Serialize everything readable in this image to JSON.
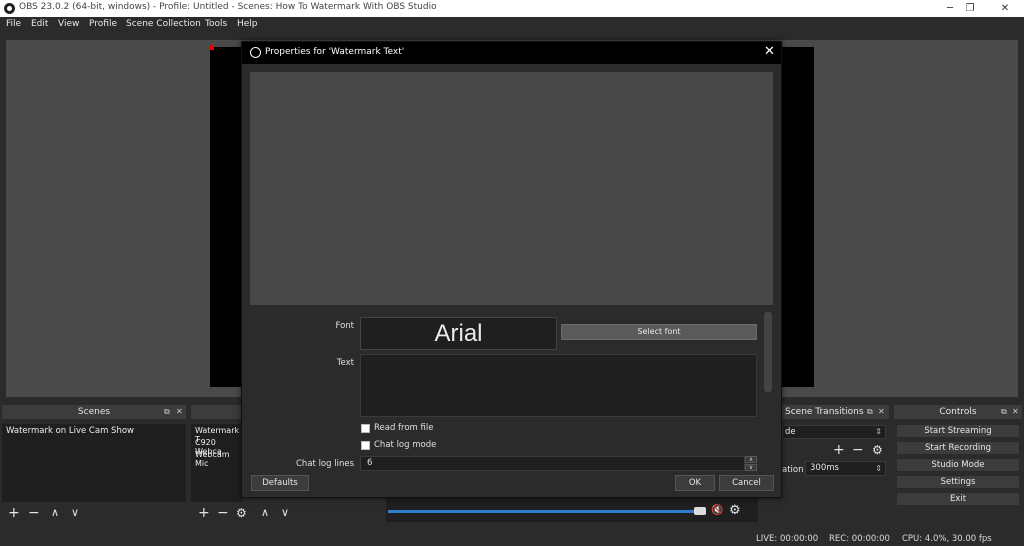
{
  "window": {
    "title": "OBS 23.0.2 (64-bit, windows) - Profile: Untitled - Scenes: How To Watermark With OBS Studio",
    "minimize_glyph": "─",
    "maximize_glyph": "❐",
    "close_glyph": "✕"
  },
  "menu": [
    "File",
    "Edit",
    "View",
    "Profile",
    "Scene Collection",
    "Tools",
    "Help"
  ],
  "dialog": {
    "title": "Properties for 'Watermark Text'",
    "close_glyph": "✕",
    "font_label": "Font",
    "font_preview": "Arial",
    "select_font_label": "Select font",
    "text_label": "Text",
    "read_from_file_label": "Read from file",
    "chat_log_mode_label": "Chat log mode",
    "chat_log_lines_label": "Chat log lines",
    "chat_log_lines_value": "6",
    "defaults_label": "Defaults",
    "ok_label": "OK",
    "cancel_label": "Cancel"
  },
  "scenes": {
    "header": "Scenes",
    "items": [
      "Watermark on Live Cam Show"
    ]
  },
  "sources": {
    "items": [
      "Watermark T",
      "C920 Webca",
      "Webcam Mic"
    ]
  },
  "transitions": {
    "header": "Scene Transitions",
    "mode_partial": "de",
    "duration_label_partial": "ation",
    "duration_value": "300ms"
  },
  "controls": {
    "header": "Controls",
    "buttons": [
      "Start Streaming",
      "Start Recording",
      "Studio Mode",
      "Settings",
      "Exit"
    ]
  },
  "status": {
    "live": "LIVE: 00:00:00",
    "rec": "REC: 00:00:00",
    "cpu": "CPU: 4.0%, 30.00 fps"
  },
  "icons": {
    "plus": "+",
    "minus": "−",
    "up": "∧",
    "down": "∨",
    "gear": "⚙",
    "float": "⧉",
    "close": "✕",
    "updown": "⇕",
    "mute": "🔇"
  },
  "colors": {
    "accent_blue": "#2f7cd0",
    "preview_bg": "#4a4a4a",
    "canvas_bg": "#000000",
    "mute_red": "#e04040"
  }
}
